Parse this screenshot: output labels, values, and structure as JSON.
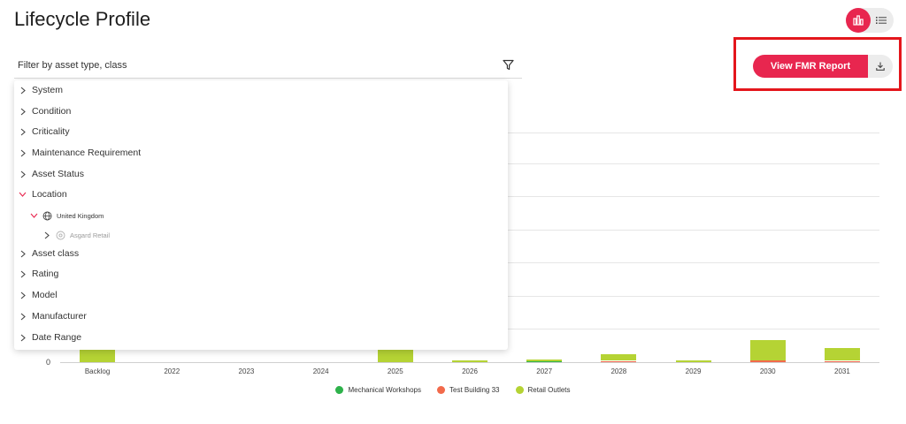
{
  "header": {
    "title": "Lifecycle Profile"
  },
  "filter": {
    "label": "Filter by asset type, class",
    "items": [
      {
        "label": "System",
        "expanded": false
      },
      {
        "label": "Condition",
        "expanded": false
      },
      {
        "label": "Criticality",
        "expanded": false
      },
      {
        "label": "Maintenance Requirement",
        "expanded": false
      },
      {
        "label": "Asset Status",
        "expanded": false
      },
      {
        "label": "Location",
        "expanded": true
      },
      {
        "label": "United Kingdom",
        "expanded": true
      },
      {
        "label": "Asgard Retail",
        "expanded": false
      },
      {
        "label": "Asset class",
        "expanded": false
      },
      {
        "label": "Rating",
        "expanded": false
      },
      {
        "label": "Model",
        "expanded": false
      },
      {
        "label": "Manufacturer",
        "expanded": false
      },
      {
        "label": "Date Range",
        "expanded": false
      }
    ]
  },
  "actions": {
    "report_label": "View FMR Report"
  },
  "colors": {
    "accent": "#e8264f",
    "highlight_border": "#e4161c"
  },
  "icons": [
    "bar-chart-icon",
    "list-icon",
    "filter-icon",
    "download-icon",
    "chevron-right-icon",
    "chevron-down-icon",
    "globe-icon",
    "location-pin-icon"
  ],
  "chart_data": {
    "type": "bar",
    "stacked": true,
    "categories": [
      "Backlog",
      "2022",
      "2023",
      "2024",
      "2025",
      "2026",
      "2027",
      "2028",
      "2029",
      "2030",
      "2031"
    ],
    "series": [
      {
        "name": "Mechanical Workshops",
        "color": "#2eb24b",
        "values": [
          0,
          0,
          0,
          0,
          0,
          0,
          0.1,
          0,
          0,
          0,
          0
        ]
      },
      {
        "name": "Test Building 33",
        "color": "#f26a4b",
        "values": [
          0,
          0,
          0,
          0,
          0,
          0,
          0,
          0.2,
          0,
          0.3,
          0.15
        ]
      },
      {
        "name": "Retail Outlets",
        "color": "#b5d334",
        "values": [
          6,
          0,
          0,
          0,
          6,
          0.3,
          0.1,
          1.0,
          0.3,
          3.0,
          2.0
        ]
      }
    ],
    "y_zero_label": "0",
    "ylim": [
      0,
      35
    ],
    "grid": true,
    "legend_position": "bottom"
  }
}
